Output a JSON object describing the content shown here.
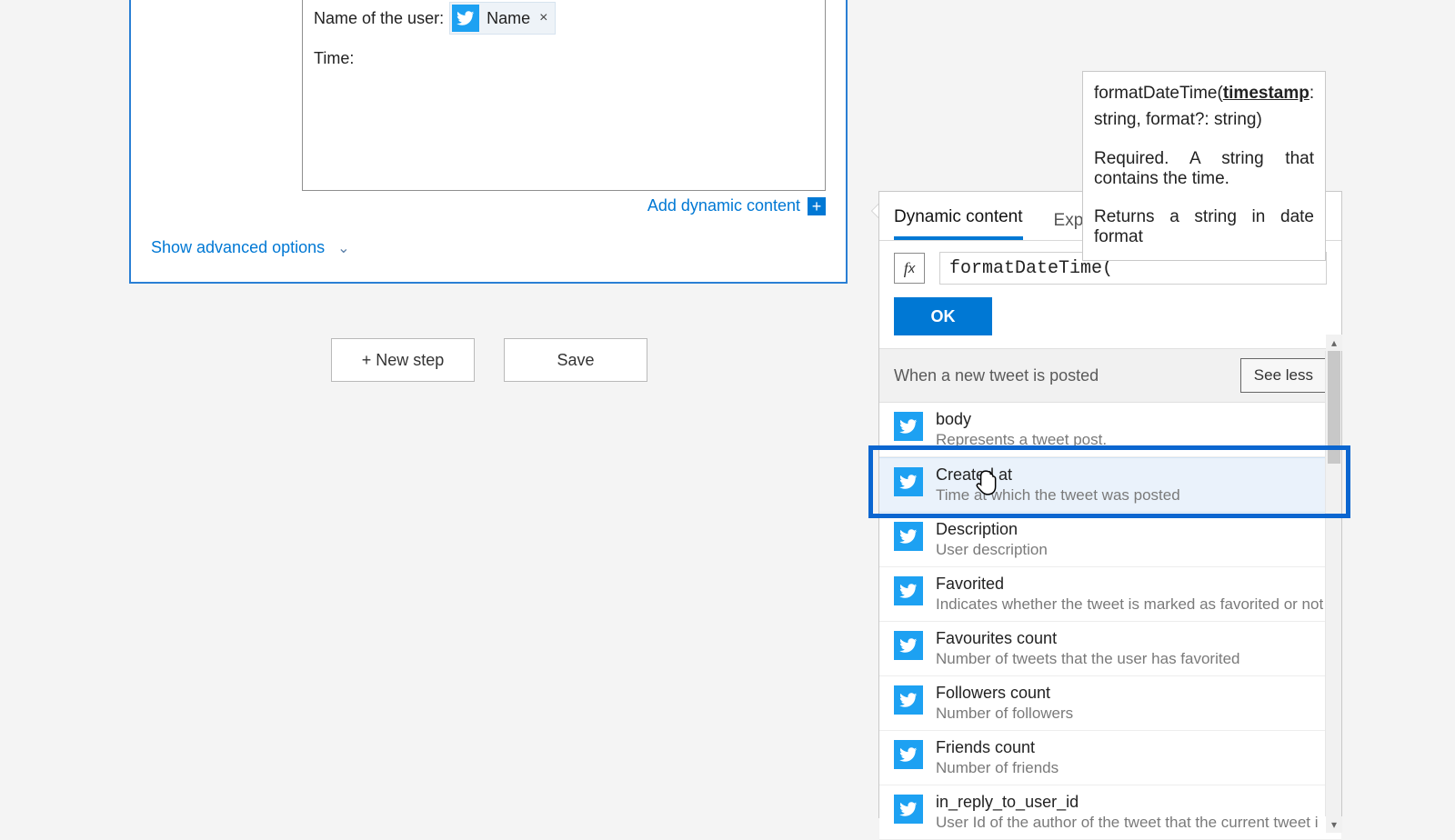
{
  "card": {
    "nameLabel": "Name of the user:",
    "tokenText": "Name",
    "tokenRemove": "×",
    "timeLabel": "Time:",
    "addDynamic": "Add dynamic content",
    "showAdvanced": "Show advanced options"
  },
  "buttons": {
    "newStep": "+ New step",
    "save": "Save"
  },
  "flyout": {
    "tabDynamic": "Dynamic content",
    "tabExpression": "Exp",
    "fxValue": "formatDateTime(",
    "ok": "OK",
    "sectionTitle": "When a new tweet is posted",
    "seeLess": "See less",
    "items": [
      {
        "title": "body",
        "desc": "Represents a tweet post."
      },
      {
        "title": "Created at",
        "desc": "Time at which the tweet was posted"
      },
      {
        "title": "Description",
        "desc": "User description"
      },
      {
        "title": "Favorited",
        "desc": "Indicates whether the tweet is marked as favorited or not"
      },
      {
        "title": "Favourites count",
        "desc": "Number of tweets that the user has favorited"
      },
      {
        "title": "Followers count",
        "desc": "Number of followers"
      },
      {
        "title": "Friends count",
        "desc": "Number of friends"
      },
      {
        "title": "in_reply_to_user_id",
        "desc": "User Id of the author of the tweet that the current tweet i"
      }
    ]
  },
  "tooltip": {
    "fn": "formatDateTime(",
    "argActive": "timestamp",
    "sigRest": ": string, format?: string)",
    "req": "Required. A string that contains the time.",
    "ret": "Returns a string in date format"
  }
}
